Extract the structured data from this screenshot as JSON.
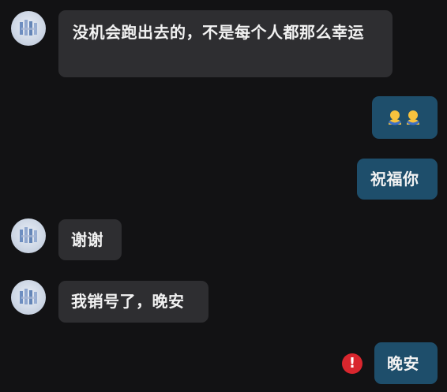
{
  "chat": {
    "messages": [
      {
        "direction": "incoming",
        "text": "没机会跑出去的，不是每个人都那么幸运"
      },
      {
        "direction": "outgoing",
        "text": "",
        "emoji": [
          "person-hugging-emoji",
          "person-hugging-emoji"
        ]
      },
      {
        "direction": "outgoing",
        "text": "祝福你"
      },
      {
        "direction": "incoming",
        "text": "谢谢"
      },
      {
        "direction": "incoming",
        "text": "我销号了，晚安"
      },
      {
        "direction": "outgoing",
        "text": "晚安",
        "status": "failed"
      }
    ],
    "error_icon_glyph": "!",
    "colors": {
      "background": "#121214",
      "incoming_bubble": "#2e2e31",
      "outgoing_bubble": "#1e4e6b",
      "error": "#d9262e"
    }
  }
}
